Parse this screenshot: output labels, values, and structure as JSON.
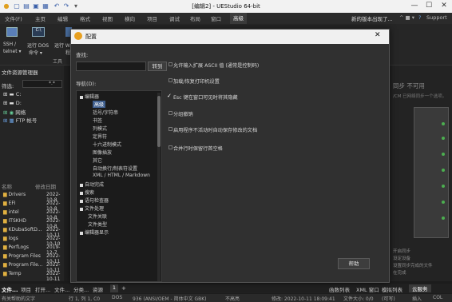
{
  "window": {
    "title": "[编辑2] - UEStudio 64-bit",
    "controls": [
      "—",
      "☐",
      "✕"
    ]
  },
  "menubar": {
    "items": [
      "文件(F)",
      "主页",
      "编辑",
      "格式",
      "视图",
      "横向",
      "项目",
      "调试",
      "布局",
      "窗口",
      "高级"
    ],
    "active_index": 10,
    "right": {
      "news": "新的版本出现了...",
      "support": "Support"
    }
  },
  "ribbon": {
    "groups": [
      "SSH / telnet",
      "运行 DOS 命令",
      "运行 W..."
    ],
    "labels": [
      "SSH /",
      "运行 DOS",
      "运行 W",
      "telnet ▾",
      "命令 ▾",
      "程"
    ],
    "tools_label": "工具"
  },
  "left_panel": {
    "title": "文件资源管理器",
    "filter_label": "筛选:",
    "filter_value": "*.*",
    "drives": [
      "C:",
      "D:",
      "网络",
      "FTP 帐号"
    ],
    "columns": [
      "名称",
      "修改日期"
    ],
    "files": [
      {
        "name": "Drivers",
        "date": "2022-10-8"
      },
      {
        "name": "EFI",
        "date": "2022-10-8"
      },
      {
        "name": "intel",
        "date": "2022-10-8"
      },
      {
        "name": "ITSKHD",
        "date": "2022-10-8"
      },
      {
        "name": "KDubaSoftD...",
        "date": "2022-10-11"
      },
      {
        "name": "logs",
        "date": "2022-10-10"
      },
      {
        "name": "PerfLogs",
        "date": "2019-12-7"
      },
      {
        "name": "Program Files",
        "date": "2022-10-11"
      },
      {
        "name": "Program File...",
        "date": "2022-10-11"
      },
      {
        "name": "Temp",
        "date": "2022-10-11"
      }
    ]
  },
  "dialog": {
    "title": "配置",
    "close": "✕",
    "search_label": "查找:",
    "search_value": "",
    "goto_button": "转到",
    "nav_label": "导航(D):",
    "tree": [
      {
        "label": "编辑器",
        "level": 0,
        "expander": "box"
      },
      {
        "label": "高级",
        "level": 1,
        "selected": true
      },
      {
        "label": "括号/字符串",
        "level": 1
      },
      {
        "label": "书签",
        "level": 1
      },
      {
        "label": "列模式",
        "level": 1
      },
      {
        "label": "定界符",
        "level": 1
      },
      {
        "label": "十六进制模式",
        "level": 1
      },
      {
        "label": "图像插放",
        "level": 1
      },
      {
        "label": "其它",
        "level": 1
      },
      {
        "label": "自动换行/制表符设置",
        "level": 1
      },
      {
        "label": "XML / HTML / Markdown",
        "level": 1
      },
      {
        "label": "自动完成",
        "level": 0,
        "expander": "box"
      },
      {
        "label": "搜索",
        "level": 0,
        "expander": "box"
      },
      {
        "label": "语句检查器",
        "level": 0,
        "expander": "box"
      },
      {
        "label": "文件处理",
        "level": 0,
        "expander": "box"
      },
      {
        "label": "文件关联",
        "level": 1
      },
      {
        "label": "文件类型",
        "level": 1
      },
      {
        "label": "编辑器显示",
        "level": 0,
        "expander": "box"
      }
    ],
    "options": [
      {
        "label": "允许输入扩展 ASCII 值 (通常是控制码)",
        "checked": false
      },
      {
        "label": "加载/恢复打印机设置",
        "checked": false
      },
      {
        "label": "Esc 键在窗口可见时将其隐藏",
        "checked": true
      },
      {
        "label": "分组撤销",
        "checked": false
      },
      {
        "label": "启用程序不活动时自动保存修改的文档",
        "checked": false
      },
      {
        "label": "合并行时保留行首空格",
        "checked": false
      }
    ],
    "help_button": "帮助"
  },
  "right_panel": {
    "texts": [
      "同步 不可用",
      "/CM 已网络同步一个选项。"
    ],
    "bottom_texts": [
      "开启同步",
      "设定设备",
      "设置同步完成的文件",
      "在完成"
    ]
  },
  "bottom_tabs": {
    "left": [
      "文件...",
      "项目",
      "打开...",
      "文件...",
      "分类...",
      "资源"
    ],
    "center": [
      "1",
      "+"
    ],
    "right": [
      "函数列表",
      "XML 窗口",
      "模拟列表",
      "云服务"
    ]
  },
  "statusbar": {
    "text": "有关帮助的文字",
    "position": "行 1, 列 1, C0",
    "format": "DOS",
    "encoding": "936 (ANSI/OEM - 简体中文 GBK)",
    "highlight": "不高亮",
    "modified": "修改: 2022-10-11 18:09:41",
    "filesize": "文件大小: 0/0",
    "rw": "(可写)",
    "insert": "插入",
    "col": "COL"
  },
  "colors": {
    "accent": "#3f5f8f",
    "dialog_bg": "#303030",
    "title_bg": "#f0f0f0"
  }
}
